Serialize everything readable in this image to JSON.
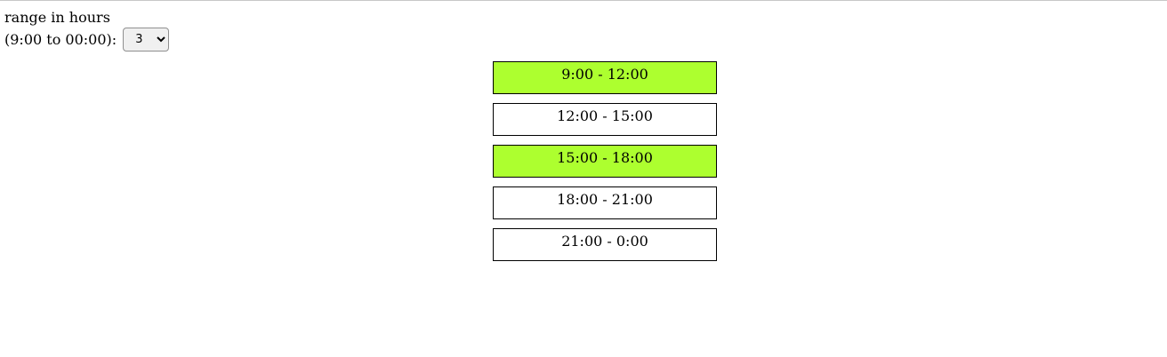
{
  "range": {
    "label_line1": "range in hours",
    "label_line2": "(9:00 to 00:00):",
    "selected": "3",
    "options": [
      "3"
    ]
  },
  "colors": {
    "highlight": "#adff2f",
    "border": "#000000"
  },
  "slots": [
    {
      "label": "9:00 - 12:00",
      "highlighted": true
    },
    {
      "label": "12:00 - 15:00",
      "highlighted": false
    },
    {
      "label": "15:00 - 18:00",
      "highlighted": true
    },
    {
      "label": "18:00 - 21:00",
      "highlighted": false
    },
    {
      "label": "21:00 - 0:00",
      "highlighted": false
    }
  ]
}
